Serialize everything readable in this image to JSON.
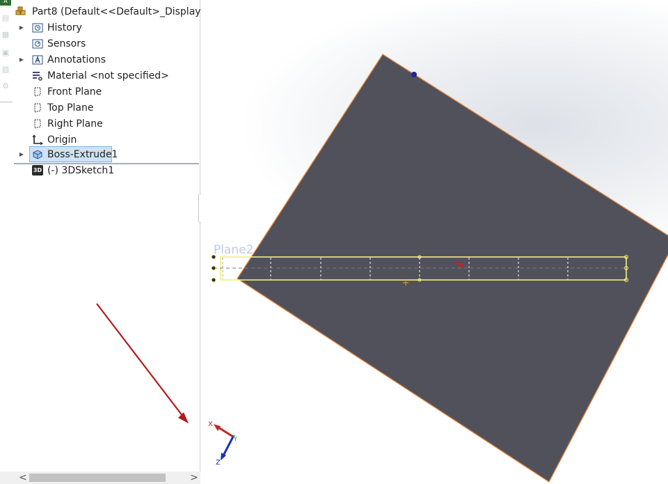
{
  "feature_tree": {
    "part": "Part8  (Default<<Default>_Display Sta",
    "items": [
      {
        "label": "History"
      },
      {
        "label": "Sensors"
      },
      {
        "label": "Annotations"
      },
      {
        "label": "Material <not specified>"
      },
      {
        "label": "Front Plane"
      },
      {
        "label": "Top Plane"
      },
      {
        "label": "Right Plane"
      },
      {
        "label": "Origin"
      },
      {
        "label": "Boss-Extrude1"
      },
      {
        "label": "(-) 3DSketch1"
      }
    ],
    "expander_glyph": "▶",
    "icon_3d_text": "3D"
  },
  "scrollbar": {
    "left_arrow": "<",
    "right_arrow": ">"
  },
  "viewport": {
    "plane_label": "Plane2",
    "triad": {
      "x_label": "X",
      "y_label": "Y",
      "z_label": "Z"
    }
  },
  "colors": {
    "face": "#51515c",
    "edge": "#e8893a",
    "sketch": "#f4f07a",
    "arrow": "#b01c1c"
  }
}
